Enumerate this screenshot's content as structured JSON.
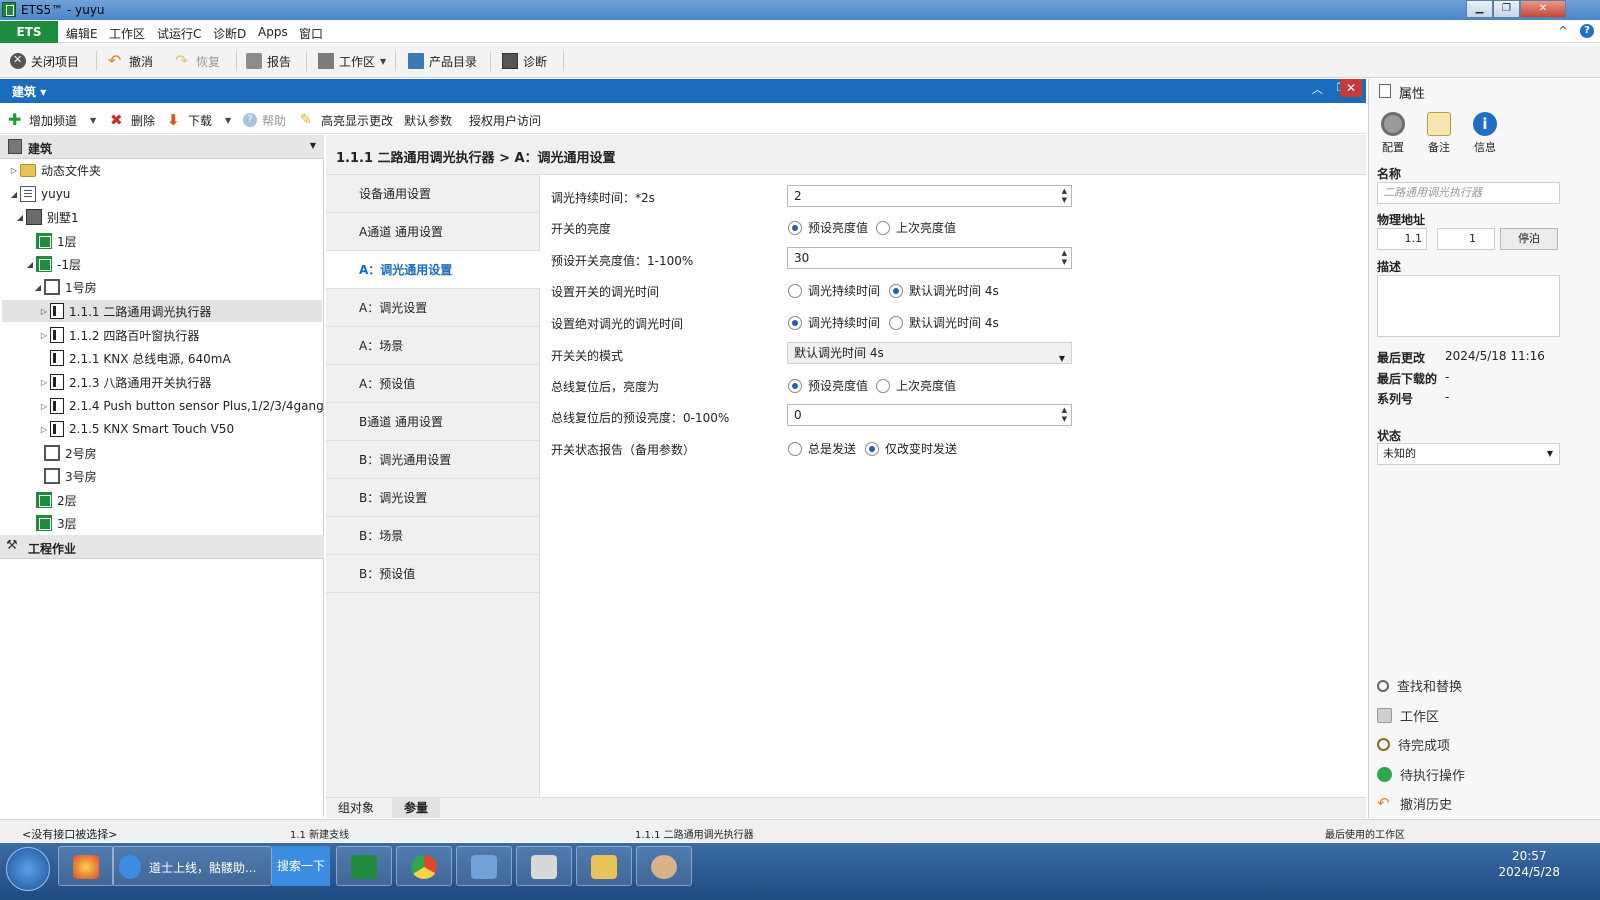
{
  "window": {
    "title": "ETS5™ - yuyu",
    "min": "▁",
    "max": "❐",
    "close": "✕"
  },
  "menu": {
    "ets": "ETS",
    "items": [
      "编辑E",
      "工作区",
      "试运行C",
      "诊断D",
      "Apps",
      "窗口"
    ],
    "caret": "^",
    "help": "?"
  },
  "toolbar": {
    "close_project": "关闭项目",
    "undo": "撤消",
    "redo": "恢复",
    "report": "报告",
    "workspace": "工作区",
    "catalog": "产品目录",
    "diagnostics": "诊断"
  },
  "panel": {
    "title": "建筑",
    "toolbar": {
      "add_channel": "增加频道",
      "delete": "删除",
      "download": "下载",
      "help": "帮助",
      "highlight": "高亮显示更改",
      "default_params": "默认参数",
      "authorize": "授权用户访问"
    }
  },
  "tree": {
    "header": "建筑",
    "dynamic_folder": "动态文件夹",
    "items": [
      {
        "label": "yuyu"
      },
      {
        "label": "别墅1"
      },
      {
        "label": "1层"
      },
      {
        "label": "-1层"
      },
      {
        "label": "1号房"
      },
      {
        "label": "1.1.1 二路通用调光执行器"
      },
      {
        "label": "1.1.2 四路百叶窗执行器"
      },
      {
        "label": "2.1.1 KNX 总线电源, 640mA"
      },
      {
        "label": "2.1.3 八路通用开关执行器"
      },
      {
        "label": "2.1.4 Push button sensor Plus,1/2/3/4gang"
      },
      {
        "label": "2.1.5 KNX Smart Touch V50"
      },
      {
        "label": "2号房"
      },
      {
        "label": "3号房"
      },
      {
        "label": "2层"
      },
      {
        "label": "3层"
      }
    ],
    "work_header": "工程作业"
  },
  "page": {
    "breadcrumb": "1.1.1 二路通用调光执行器 > A：调光通用设置",
    "categories": [
      "设备通用设置",
      "A通道 通用设置",
      "A：调光通用设置",
      "A：调光设置",
      "A：场景",
      "A：预设值",
      "B通道 通用设置",
      "B：调光通用设置",
      "B：调光设置",
      "B：场景",
      "B：预设值"
    ],
    "params": {
      "dim_duration": {
        "label": "调光持续时间：*2s",
        "value": "2"
      },
      "switch_brightness": {
        "label": "开关的亮度",
        "opt1": "预设亮度值",
        "opt2": "上次亮度值"
      },
      "preset_value": {
        "label": "预设开关亮度值：1-100%",
        "value": "30"
      },
      "switch_dim_time": {
        "label": "设置开关的调光时间",
        "opt1": "调光持续时间",
        "opt2": "默认调光时间 4s"
      },
      "absolute_dim_time": {
        "label": "设置绝对调光的调光时间",
        "opt1": "调光持续时间",
        "opt2": "默认调光时间 4s"
      },
      "switch_mode": {
        "label": "开关关的模式",
        "value": "默认调光时间 4s"
      },
      "bus_reset": {
        "label": "总线复位后，亮度为",
        "opt1": "预设亮度值",
        "opt2": "上次亮度值"
      },
      "bus_reset_preset": {
        "label": "总线复位后的预设亮度：0-100%",
        "value": "0"
      },
      "status_report": {
        "label": "开关状态报告（备用参数）",
        "opt1": "总是发送",
        "opt2": "仅改变时发送"
      }
    },
    "bottom_tabs": [
      "组对象",
      "参量"
    ]
  },
  "props": {
    "title": "属性",
    "tabs": [
      "配置",
      "备注",
      "信息"
    ],
    "name_label": "名称",
    "name_placeholder": "二路通用调光执行器",
    "address_label": "物理地址",
    "address_prefix": "1.1",
    "address_value": "1",
    "park_button": "停泊",
    "desc_label": "描述",
    "last_modified_label": "最后更改",
    "last_modified": "2024/5/18 11:16",
    "last_download_label": "最后下载的",
    "last_download": "-",
    "serial_label": "系列号",
    "serial": "-",
    "state_label": "状态",
    "state_value": "未知的",
    "links": [
      "查找和替换",
      "工作区",
      "待完成项",
      "待执行操作",
      "撤消历史"
    ]
  },
  "statusbar": {
    "interface": "<没有接口被选择>",
    "line": "1.1 新建支线",
    "device": "1.1.1 二路通用调光执行器",
    "workspace": "最后使用的工作区"
  },
  "taskbar": {
    "ie_title": "道士上线，骷髅助...",
    "search": "搜索一下",
    "time": "20:57",
    "date": "2024/5/28"
  },
  "colors": {
    "accent": "#1a6cbd",
    "ets_green": "#1e8b3d",
    "close_red": "#c43b3b"
  }
}
